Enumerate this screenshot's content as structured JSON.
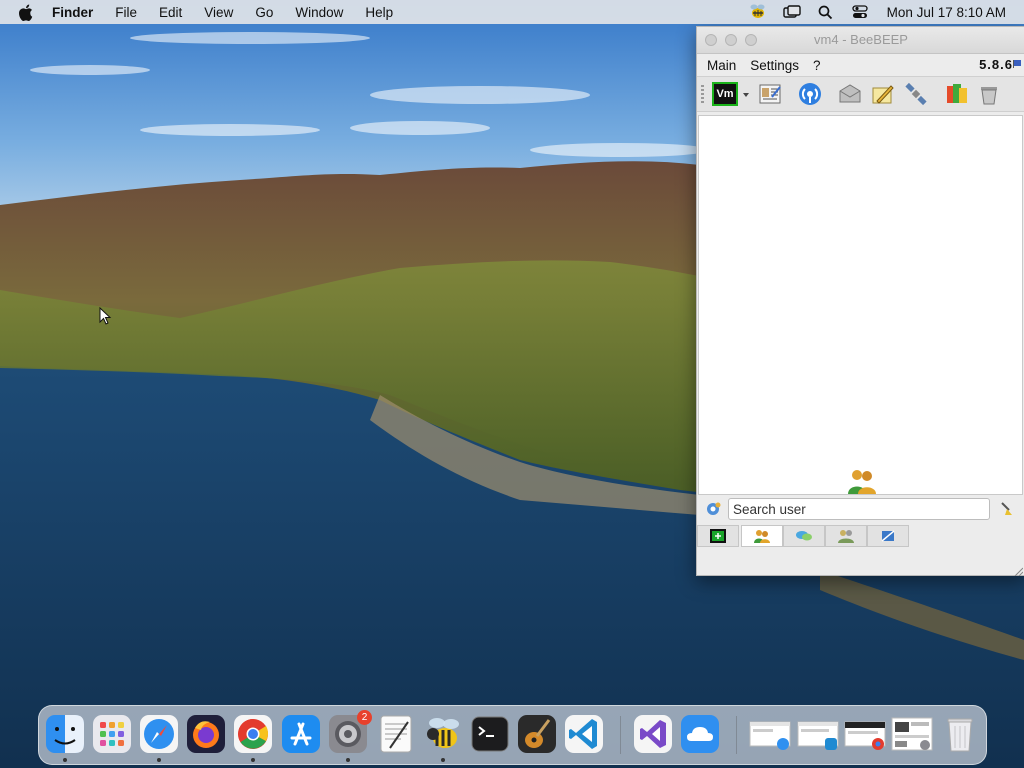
{
  "menubar": {
    "app_name": "Finder",
    "items": [
      "File",
      "Edit",
      "View",
      "Go",
      "Window",
      "Help"
    ],
    "status_icons": [
      "beebeep-status-icon",
      "screen-mirroring-icon",
      "search-icon",
      "control-center-icon"
    ],
    "clock": "Mon Jul 17  8:10 AM"
  },
  "window": {
    "title": "vm4 - BeeBEEP",
    "menu": {
      "main": "Main",
      "settings": "Settings",
      "help": "?"
    },
    "version": "5.8.6",
    "toolbar": {
      "vm_label": "Vm",
      "icons": [
        "profile-icon",
        "network-icon",
        "message-icon",
        "note-icon",
        "satellite-icon",
        "files-icon",
        "clear-icon"
      ]
    },
    "search": {
      "placeholder": "Search user"
    },
    "tabs": [
      "new-chat-tab",
      "users-tab",
      "chats-tab",
      "groups-tab",
      "log-tab"
    ]
  },
  "dock": {
    "apps": [
      "Finder",
      "Launchpad",
      "Safari",
      "Firefox",
      "Chrome",
      "App Store",
      "System Preferences",
      "TextEdit",
      "BeeBEEP",
      "Terminal",
      "GarageBand",
      "Visual Studio Code",
      "Visual Studio",
      "Cloud",
      "Minimized window 1",
      "Minimized window 2",
      "Minimized window 3",
      "Minimized window 4",
      "Trash"
    ],
    "system_prefs_badge": "2"
  },
  "colors": {
    "sky_top": "#3f7fcf",
    "sea": "#1c4a78",
    "mountain": "#6d6a3d",
    "accent_green": "#1a8a2a",
    "badge_red": "#e8412c"
  }
}
